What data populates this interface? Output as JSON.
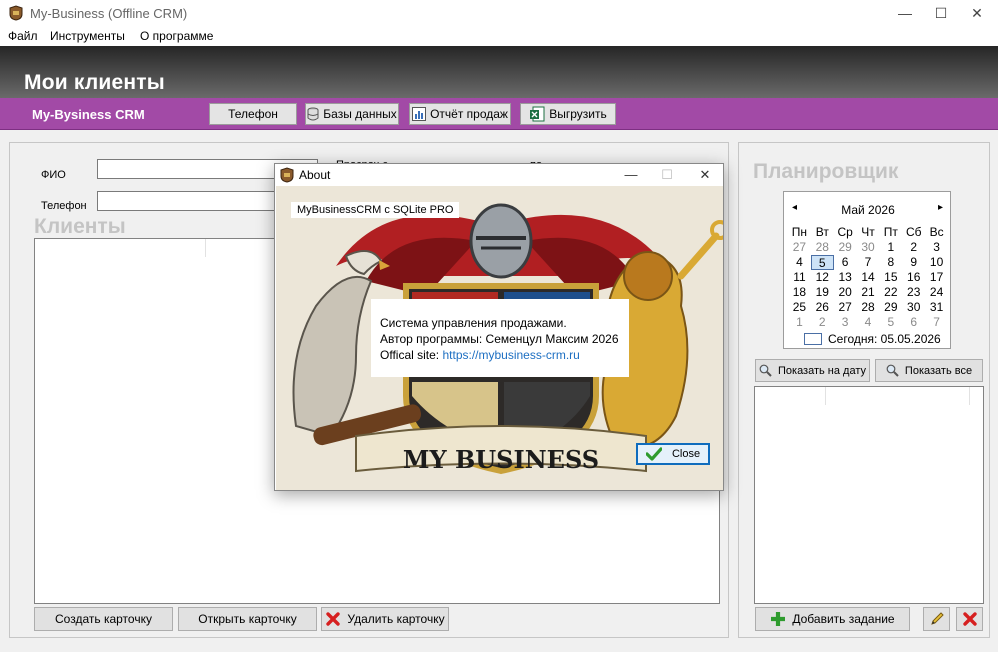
{
  "window": {
    "title": "My-Business (Offline CRM)",
    "minimize": "—",
    "maximize": "☐",
    "close": "✕"
  },
  "menu": {
    "file": "Файл",
    "tools": "Инструменты",
    "about": "О программе"
  },
  "header": {
    "title": "Мои клиенты",
    "brand": "My-Bysiness CRM"
  },
  "toolbar": {
    "phone": "Телефон",
    "databases": "Базы данных",
    "sales_report": "Отчёт продаж",
    "export": "Выгрузить"
  },
  "filters": {
    "fio_label": "ФИО",
    "phone_label": "Телефон",
    "overdue_label": "Просроч с",
    "to_label": "по"
  },
  "clients": {
    "heading": "Клиенты"
  },
  "client_buttons": {
    "create": "Создать карточку",
    "open": "Открыть карточку",
    "delete": "Удалить карточку"
  },
  "planner": {
    "heading": "Планировщик",
    "calendar": {
      "month": "Май 2026",
      "prev": "◂",
      "next": "▸",
      "weekdays": [
        "Пн",
        "Вт",
        "Ср",
        "Чт",
        "Пт",
        "Сб",
        "Вс"
      ],
      "days": [
        {
          "d": "27",
          "dim": true
        },
        {
          "d": "28",
          "dim": true
        },
        {
          "d": "29",
          "dim": true
        },
        {
          "d": "30",
          "dim": true
        },
        {
          "d": "1"
        },
        {
          "d": "2"
        },
        {
          "d": "3"
        },
        {
          "d": "4"
        },
        {
          "d": "5",
          "today": true
        },
        {
          "d": "6"
        },
        {
          "d": "7"
        },
        {
          "d": "8"
        },
        {
          "d": "9"
        },
        {
          "d": "10"
        },
        {
          "d": "11"
        },
        {
          "d": "12"
        },
        {
          "d": "13"
        },
        {
          "d": "14"
        },
        {
          "d": "15"
        },
        {
          "d": "16"
        },
        {
          "d": "17"
        },
        {
          "d": "18"
        },
        {
          "d": "19"
        },
        {
          "d": "20"
        },
        {
          "d": "21"
        },
        {
          "d": "22"
        },
        {
          "d": "23"
        },
        {
          "d": "24"
        },
        {
          "d": "25"
        },
        {
          "d": "26"
        },
        {
          "d": "27"
        },
        {
          "d": "28"
        },
        {
          "d": "29"
        },
        {
          "d": "30"
        },
        {
          "d": "31"
        },
        {
          "d": "1",
          "dim": true
        },
        {
          "d": "2",
          "dim": true
        },
        {
          "d": "3",
          "dim": true
        },
        {
          "d": "4",
          "dim": true
        },
        {
          "d": "5",
          "dim": true
        },
        {
          "d": "6",
          "dim": true
        },
        {
          "d": "7",
          "dim": true
        }
      ],
      "today_label": "Сегодня: 05.05.2026"
    },
    "show_by_date": "Показать на дату",
    "show_all": "Показать все",
    "add_task": "Добавить задание"
  },
  "dialog": {
    "title": "About",
    "version": "MyBusinessCRM c SQLite PRO",
    "line1": "Система управления продажами.",
    "line2": "Автор программы: Семенцул Максим 2026",
    "site_label": "Offical site:",
    "site_url": "https://mybusiness-crm.ru",
    "art_text": "MY BUSINESS",
    "close": "Close"
  }
}
